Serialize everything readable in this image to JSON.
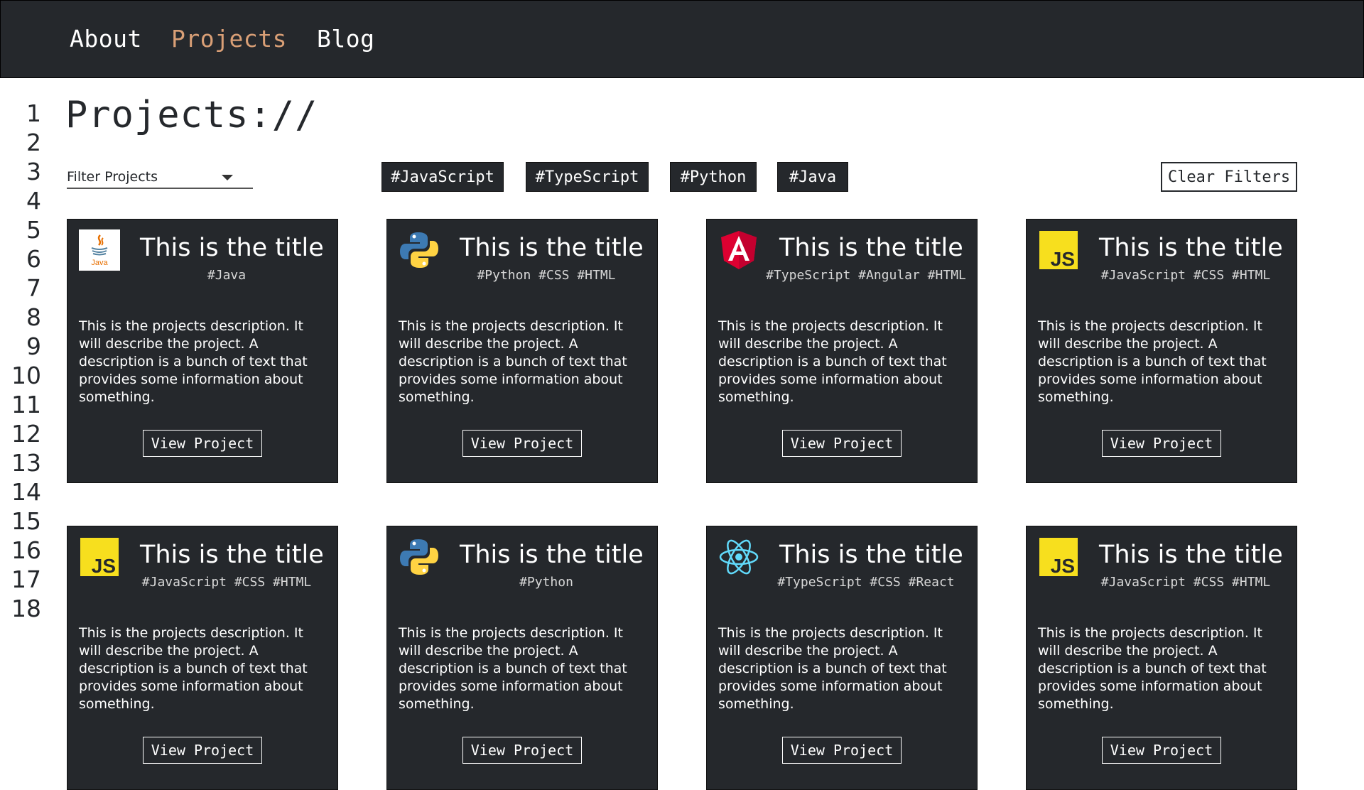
{
  "nav": {
    "items": [
      {
        "label": "About",
        "active": false
      },
      {
        "label": "Projects",
        "active": true
      },
      {
        "label": "Blog",
        "active": false
      }
    ],
    "active_color": "#d99f76"
  },
  "gutter": {
    "lines": [
      "1",
      "2",
      "3",
      "4",
      "5",
      "6",
      "7",
      "8",
      "9",
      "10",
      "11",
      "12",
      "13",
      "14",
      "15",
      "16",
      "17",
      "18"
    ]
  },
  "page": {
    "title": "Projects://"
  },
  "filters": {
    "select_label": "Filter Projects",
    "tags": [
      "#JavaScript",
      "#TypeScript",
      "#Python",
      "#Java"
    ],
    "clear_label": "Clear Filters"
  },
  "cards": [
    {
      "icon": "java-icon",
      "title": "This is the title",
      "tags": "#Java",
      "description": "This is the projects description. It will describe the project. A description is a bunch of text that provides some information about something.",
      "button": "View Project"
    },
    {
      "icon": "python-icon",
      "title": "This is the title",
      "tags": "#Python #CSS #HTML",
      "description": "This is the projects description. It will describe the project. A description is a bunch of text that provides some information about something.",
      "button": "View Project"
    },
    {
      "icon": "angular-icon",
      "title": "This is the title",
      "tags": "#TypeScript #Angular #HTML",
      "description": "This is the projects description. It will describe the project. A description is a bunch of text that provides some information about something.",
      "button": "View Project"
    },
    {
      "icon": "javascript-icon",
      "title": "This is the title",
      "tags": "#JavaScript #CSS #HTML",
      "description": "This is the projects description. It will describe the project. A description is a bunch of text that provides some information about something.",
      "button": "View Project"
    },
    {
      "icon": "javascript-icon",
      "title": "This is the title",
      "tags": "#JavaScript #CSS #HTML",
      "description": "This is the projects description. It will describe the project. A description is a bunch of text that provides some information about something.",
      "button": "View Project"
    },
    {
      "icon": "python-icon",
      "title": "This is the title",
      "tags": "#Python",
      "description": "This is the projects description. It will describe the project. A description is a bunch of text that provides some information about something.",
      "button": "View Project"
    },
    {
      "icon": "react-icon",
      "title": "This is the title",
      "tags": "#TypeScript #CSS #React",
      "description": "This is the projects description. It will describe the project. A description is a bunch of text that provides some information about something.",
      "button": "View Project"
    },
    {
      "icon": "javascript-icon",
      "title": "This is the title",
      "tags": "#JavaScript #CSS #HTML",
      "description": "This is the projects description. It will describe the project. A description is a bunch of text that provides some information about something.",
      "button": "View Project"
    }
  ],
  "logo_text": {
    "java": "Java",
    "javascript": "JS"
  },
  "colors": {
    "card_bg": "#25282c",
    "js_yellow": "#f7df1e",
    "python_blue": "#3d7ab3",
    "python_yellow": "#ffd343",
    "angular_red": "#dd0031",
    "react_cyan": "#61dafb"
  }
}
